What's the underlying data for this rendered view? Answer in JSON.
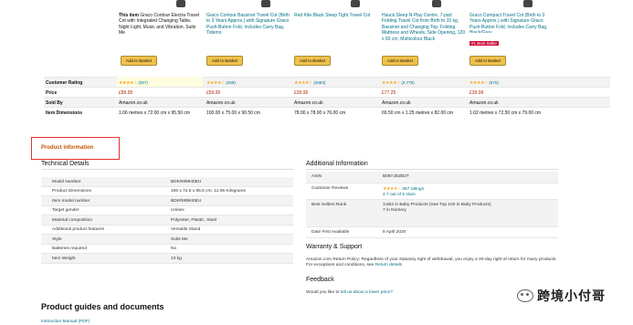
{
  "comparison": {
    "products": [
      {
        "title_bold": "This item",
        "title": "Graco Contour Electra Travel Cot with Integrated Changing Table, Night Light, Music and Vibration, Suits Me",
        "badge": "",
        "button": "Add to Basket"
      },
      {
        "title_bold": "",
        "title": "Graco Contour Bassinet Travel Cot (Birth to 3 Years Approx.) with Signature Graco Push-Button Fold, Includes Carry Bag, Tidemo",
        "badge": "",
        "button": "Add to Basket"
      },
      {
        "title_bold": "",
        "title": "Red Kite Black Sleep Tight Travel Cot",
        "badge": "",
        "button": "Add to Basket"
      },
      {
        "title_bold": "",
        "title": "Hauck Sleep N Play Centre, 7-part Folding Travel Cot from Birth to 15 kg, Bassinet and Changing Top, Folding Mattress and Wheels, Side Opening, 120 x 60 cm, Multicolour Black",
        "badge": "",
        "button": "Add to Basket"
      },
      {
        "title_bold": "",
        "title": "Graco Compact Travel Cot (Birth to 3 Years Approx.) with Signature Graco Push-Button Fold, Includes Carry Bag, Black/Grey",
        "badge": "#1 Best Seller",
        "button": "Add to Basket"
      }
    ],
    "row_labels": [
      "Customer Rating",
      "Price",
      "Sold By",
      "Item Dimensions"
    ],
    "ratings": [
      {
        "stars": "★★★★☆",
        "count": "(357)"
      },
      {
        "stars": "★★★★☆",
        "count": "(259)"
      },
      {
        "stars": "★★★★☆",
        "count": "(4083)"
      },
      {
        "stars": "★★★★☆",
        "count": "(2,775)"
      },
      {
        "stars": "★★★★☆",
        "count": "(675)"
      }
    ],
    "prices": [
      "£89.95",
      "£59.95",
      "£39.95",
      "£77.25",
      "£39.99"
    ],
    "sellers": [
      "Amazon.co.uk",
      "Amazon.co.uk",
      "Amazon.co.uk",
      "Amazon.co.uk",
      "Amazon.co.uk"
    ],
    "dimensions": [
      "1.06 metres x 72.00 cm x 95.50 cm",
      "100.00 x 75.00 x 90.50 cm",
      "78.00 x 78.00 x 76.00 cm",
      "69.50 cm x 1.25 metres x 82.00 cm",
      "1.02 metres x 72.50 cm x 79.00 cm"
    ]
  },
  "product_information": {
    "title": "Product information"
  },
  "technical_details": {
    "heading": "Technical Details",
    "rows": [
      {
        "k": "Model Number",
        "v": "BDKR89940EU"
      },
      {
        "k": "Product Dimensions",
        "v": "106 x 72.5 x 95.5 cm; 12.65 Kilograms"
      },
      {
        "k": "Item model number",
        "v": "BDKR89940EU"
      },
      {
        "k": "Target gender",
        "v": "Unisex"
      },
      {
        "k": "Material composition",
        "v": "Polyester, Plastic, Steel"
      },
      {
        "k": "Additional product features",
        "v": "Versatile Stand"
      },
      {
        "k": "Style",
        "v": "Suits Me"
      },
      {
        "k": "Batteries required",
        "v": "No"
      },
      {
        "k": "Item Weight",
        "v": "13 kg"
      }
    ]
  },
  "additional_information": {
    "heading": "Additional Information",
    "asin_k": "ASIN",
    "asin_v": "B087JDZB2T",
    "review_k": "Customer Reviews",
    "review_stars": "★★★★☆",
    "review_count": "357 ratings",
    "review_text": "4.7 out of 5 stars",
    "rank_k": "Best Sellers Rank",
    "rank_v1": "3,662 in Baby Products (See Top 100 in Baby Products)",
    "rank_v2": "7 in Nursery",
    "date_k": "Date First Available",
    "date_v": "8 April 2020"
  },
  "warranty": {
    "heading": "Warranty & Support",
    "text": "Amazon.com Return Policy: Regardless of your statutory right of withdrawal, you enjoy a 30-day right of return for many products. For exceptions and conditions, see",
    "link": "Return details"
  },
  "feedback": {
    "heading": "Feedback",
    "text": "Would you like to",
    "link": "tell us about a lower price?"
  },
  "guides": {
    "heading": "Product guides and documents",
    "manual": "Instruction Manual (PDF)"
  },
  "watermark": {
    "text": "跨境小付哥"
  }
}
